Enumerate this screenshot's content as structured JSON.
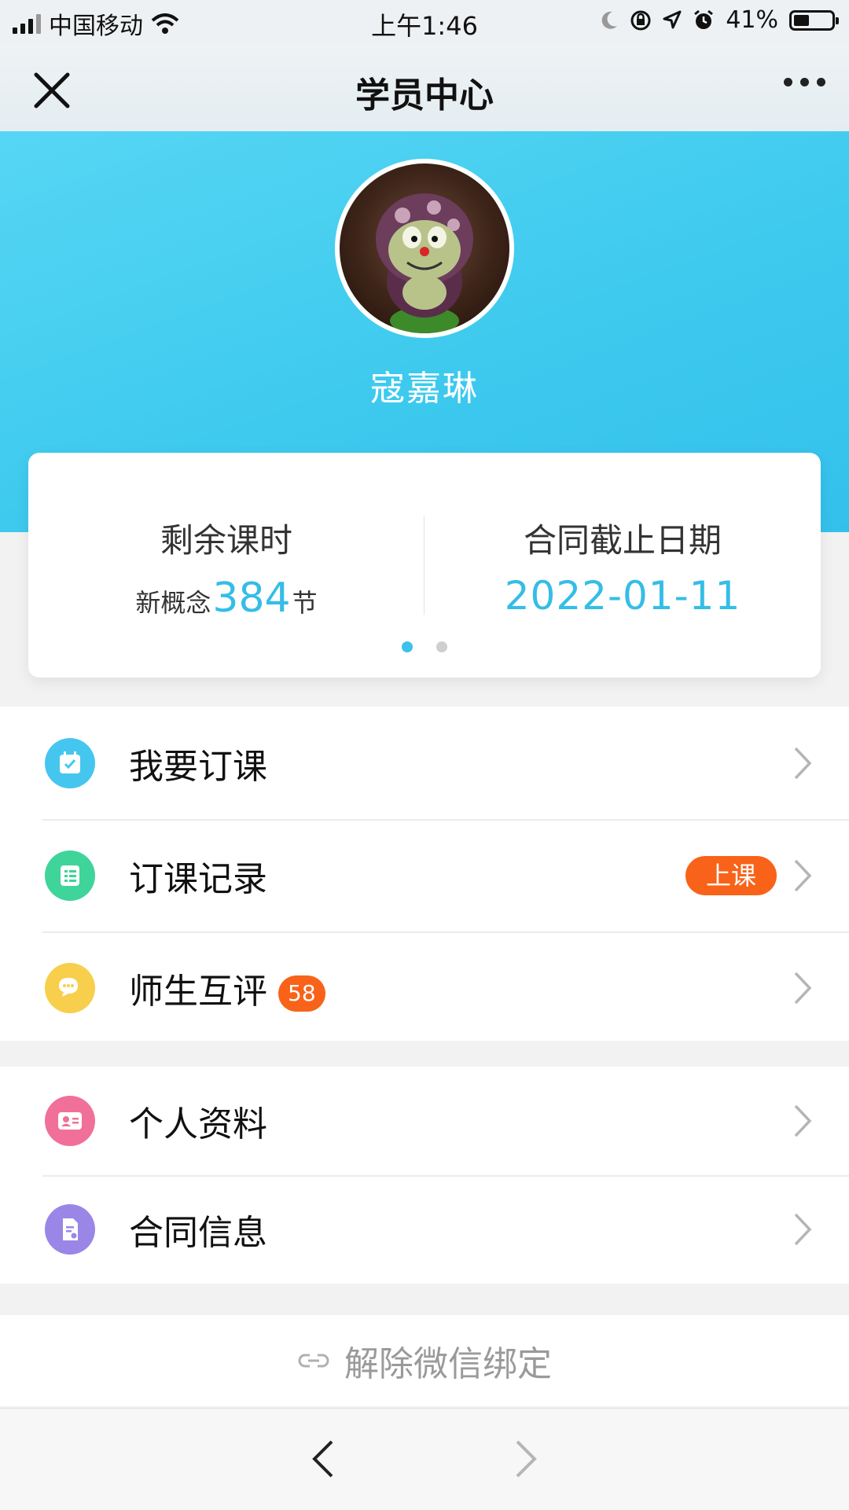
{
  "status_bar": {
    "carrier": "中国移动",
    "time": "上午1:46",
    "battery_percent": "41%",
    "battery_level": 0.41,
    "icons": [
      "signal-icon",
      "wifi-icon",
      "moon-icon",
      "orientation-lock-icon",
      "location-icon",
      "alarm-icon",
      "battery-icon"
    ]
  },
  "navbar": {
    "title": "学员中心",
    "icons": [
      "close-icon",
      "more-icon"
    ]
  },
  "profile": {
    "name": "寇嘉琳",
    "avatar_icon": "avatar-photo"
  },
  "summary_card": {
    "left": {
      "label": "剩余课时",
      "prefix": "新概念",
      "value": "384",
      "suffix": "节"
    },
    "right": {
      "label": "合同截止日期",
      "value": "2022-01-11"
    },
    "pager": {
      "pages": 2,
      "active": 1
    },
    "accent": "#35bde6"
  },
  "menu_group_1": [
    {
      "label": "我要订课",
      "icon": "calendar-check-icon",
      "icon_color": "#45c6ef"
    },
    {
      "label": "订课记录",
      "icon": "list-icon",
      "icon_color": "#3ed49a",
      "tag": "上课"
    },
    {
      "label": "师生互评",
      "icon": "chat-bubble-icon",
      "icon_color": "#f8cf4c",
      "count": "58"
    }
  ],
  "menu_group_2": [
    {
      "label": "个人资料",
      "icon": "id-card-icon",
      "icon_color": "#f0709a"
    },
    {
      "label": "合同信息",
      "icon": "document-icon",
      "icon_color": "#9a86e6"
    }
  ],
  "unbind": {
    "label": "解除微信绑定",
    "icon": "link-icon"
  },
  "bottom_bar": {
    "icons": [
      "back-arrow-icon",
      "forward-arrow-icon"
    ]
  },
  "colors": {
    "hero": "#3ecaee",
    "badge": "#f86319"
  }
}
